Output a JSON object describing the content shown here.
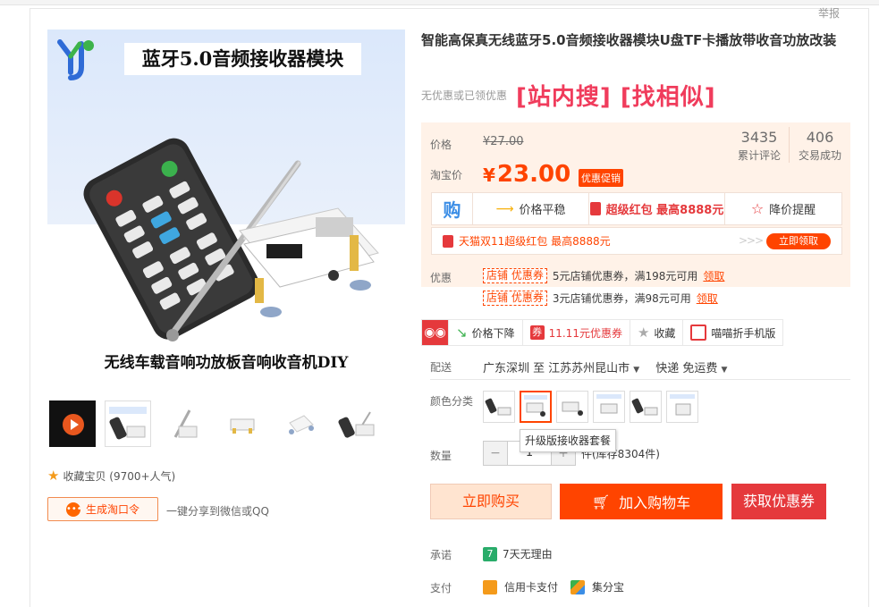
{
  "header": {
    "report": "举报"
  },
  "gallery": {
    "banner_text": "蓝牙5.0音频接收器模块",
    "caption": "无线车载音响功放板音响收音机DIY",
    "thumbnails": [
      "video-thumb",
      "thumb-2",
      "thumb-3",
      "thumb-4",
      "thumb-5",
      "thumb-6"
    ],
    "favorite": "收藏宝贝 (9700+人气)",
    "gen_button": "生成淘口令",
    "share_text": "一键分享到微信或QQ"
  },
  "product": {
    "title": "智能高保真无线蓝牙5.0音频接收器模块U盘TF卡播放带收音功放改装",
    "no_coupon": "无优惠或已领优惠",
    "search_links": "[站内搜] [找相似]",
    "price_label": "价格",
    "old_price": "¥27.00",
    "tb_price_label": "淘宝价",
    "yen": "¥",
    "now_price": "23.00",
    "promo_tag": "优惠促销",
    "reviews_count": "3435",
    "reviews_label": "累计评论",
    "sales_count": "406",
    "sales_label": "交易成功",
    "tools": {
      "gou": "购",
      "price_flat": "价格平稳",
      "red_packet": "超级红包 最高8888元",
      "alert": "降价提醒"
    },
    "tmall_text": "天猫双11超级红包 最高8888元",
    "tmall_arrows": ">>>",
    "tmall_btn": "立即领取",
    "coupon_label": "优惠",
    "coupons": [
      {
        "tag": "店铺 优惠券",
        "text": "5元店铺优惠券，满198元可用",
        "get": "领取"
      },
      {
        "tag": "店铺 优惠券",
        "text": "3元店铺优惠券，满98元可用",
        "get": "领取"
      }
    ],
    "actions": {
      "price_drop": "价格下降",
      "coupon1111": "11.11元优惠券",
      "quan": "券",
      "collect": "收藏",
      "mobile": "喵喵折手机版"
    },
    "ship_label": "配送",
    "ship_from": "广东深圳 至",
    "ship_to": "江苏苏州昆山市",
    "ship_method": "快递 免运费",
    "color_label": "颜色分类",
    "tooltip": "升级版接收器套餐",
    "qty_label": "数量",
    "qty_minus": "−",
    "qty_value": "1",
    "qty_plus": "+",
    "stock": "件(库存8304件)",
    "buy_btn": "立即购买",
    "cart_btn": "加入购物车",
    "coupon_btn": "获取优惠券",
    "promise_label": "承诺",
    "promise_icon": "7",
    "promise_text": "7天无理由",
    "pay_label": "支付",
    "pay_credit": "信用卡支付",
    "pay_jifen": "集分宝"
  }
}
